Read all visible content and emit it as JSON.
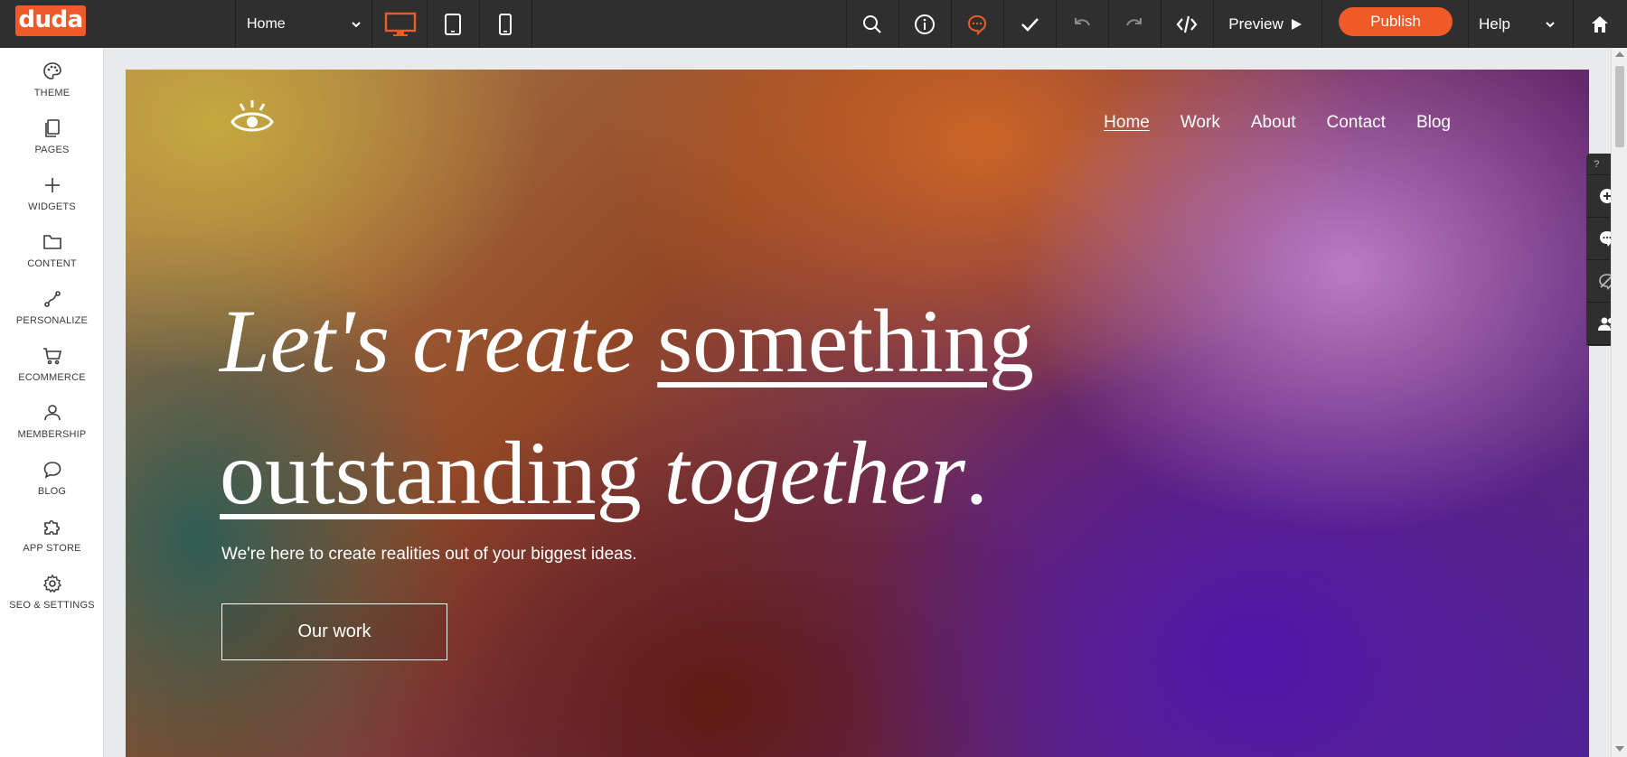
{
  "topbar": {
    "logo_text": "duda",
    "page_selector": "Home",
    "preview_label": "Preview",
    "publish_label": "Publish",
    "help_label": "Help",
    "accent_color": "#f05a28"
  },
  "sidebar": {
    "items": [
      {
        "label": "THEME",
        "icon": "palette-icon"
      },
      {
        "label": "PAGES",
        "icon": "pages-icon"
      },
      {
        "label": "WIDGETS",
        "icon": "plus-icon"
      },
      {
        "label": "CONTENT",
        "icon": "folder-icon"
      },
      {
        "label": "PERSONALIZE",
        "icon": "personalize-icon"
      },
      {
        "label": "ECOMMERCE",
        "icon": "cart-icon"
      },
      {
        "label": "MEMBERSHIP",
        "icon": "user-icon"
      },
      {
        "label": "BLOG",
        "icon": "chat-bubble-icon"
      },
      {
        "label": "APP STORE",
        "icon": "puzzle-icon"
      },
      {
        "label": "SEO & SETTINGS",
        "icon": "gear-icon"
      }
    ]
  },
  "site": {
    "nav": [
      "Home",
      "Work",
      "About",
      "Contact",
      "Blog"
    ],
    "headline_1_italic": "Let's create ",
    "headline_1_underline": "something",
    "headline_2_underline": "outstanding",
    "headline_2_italic": " together",
    "headline_2_end": ".",
    "subline": "We're here to create realities out of your biggest ideas.",
    "cta": "Our work"
  },
  "float_tools": {
    "help": "?",
    "close": "✕"
  }
}
